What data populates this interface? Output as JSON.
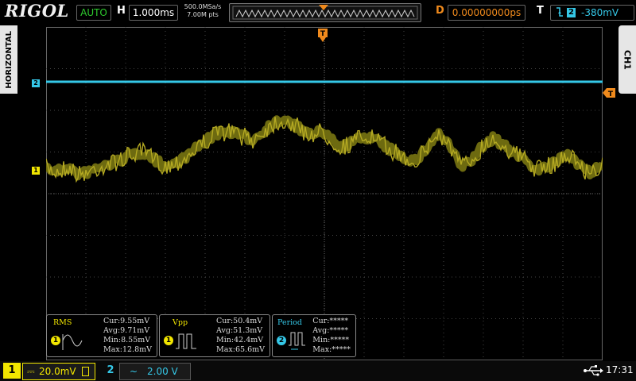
{
  "brand": {
    "logo": "RIGOL"
  },
  "header": {
    "mode": "AUTO",
    "h_label": "H",
    "timebase": "1.000ms",
    "sample_rate": "500.0MSa/s",
    "memory_depth": "7.00M pts",
    "d_label": "D",
    "delay": "0.00000000ps",
    "t_label": "T",
    "trigger_source": "2",
    "trigger_level": "-380mV"
  },
  "side_tabs": {
    "left": "HORIZONTAL",
    "right": "CH1"
  },
  "markers": {
    "ch1": "1",
    "ch2": "2",
    "trigger_pos": "T",
    "trigger_level": "T"
  },
  "measurements": [
    {
      "title": "RMS",
      "channel": "1",
      "rows": [
        "Cur:9.55mV",
        "Avg:9.71mV",
        "Min:8.55mV",
        "Max:12.8mV"
      ]
    },
    {
      "title": "Vpp",
      "channel": "1",
      "rows": [
        "Cur:50.4mV",
        "Avg:51.3mV",
        "Min:42.4mV",
        "Max:65.6mV"
      ]
    },
    {
      "title": "Period",
      "channel": "2",
      "rows": [
        "Cur:*****",
        "Avg:*****",
        "Min:*****",
        "Max:*****"
      ]
    }
  ],
  "footer": {
    "ch1_label": "1",
    "ch1_scale": "20.0mV",
    "ch2_label": "2",
    "ch2_scale": "2.00 V",
    "time": "17:31"
  },
  "colors": {
    "ch1": "#f2e600",
    "ch2": "#35c8e8",
    "trigger": "#f08a1c",
    "grid": "#555555"
  },
  "icons": {
    "coupling_ch1": "dc-coupling-icon",
    "coupling_ch2": "ac-coupling-icon",
    "usb": "usb-icon",
    "trigger_edge": "falling-edge-icon"
  }
}
